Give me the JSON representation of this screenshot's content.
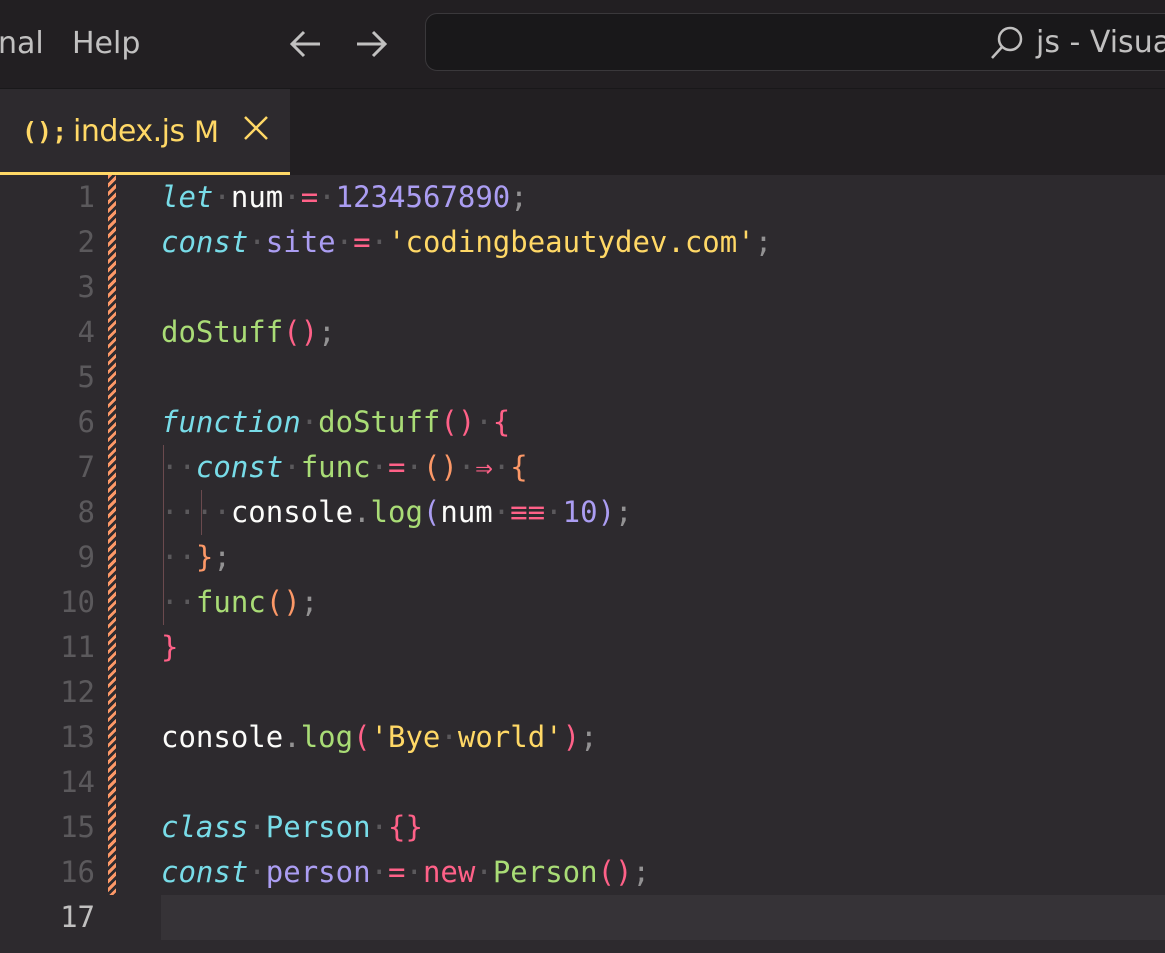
{
  "menu": {
    "items": [
      "nal",
      "Help"
    ]
  },
  "search": {
    "text": "js - Visual"
  },
  "tab": {
    "icon_text": "();",
    "filename": "index.js",
    "status": "M"
  },
  "editor": {
    "active_line": 17,
    "line_numbers": [
      "1",
      "2",
      "3",
      "4",
      "5",
      "6",
      "7",
      "8",
      "9",
      "10",
      "11",
      "12",
      "13",
      "14",
      "15",
      "16",
      "17"
    ],
    "lines": [
      [
        [
          "kw-i",
          "let"
        ],
        [
          "ws",
          "·"
        ],
        [
          "var",
          "num"
        ],
        [
          "ws",
          "·"
        ],
        [
          "op",
          "="
        ],
        [
          "ws",
          "·"
        ],
        [
          "num",
          "1234567890"
        ],
        [
          "punct",
          ";"
        ]
      ],
      [
        [
          "kw-i",
          "const"
        ],
        [
          "ws",
          "·"
        ],
        [
          "prop",
          "site"
        ],
        [
          "ws",
          "·"
        ],
        [
          "op",
          "="
        ],
        [
          "ws",
          "·"
        ],
        [
          "str",
          "'codingbeautydev.com'"
        ],
        [
          "punct",
          ";"
        ]
      ],
      [],
      [
        [
          "fn",
          "doStuff"
        ],
        [
          "br1",
          "()"
        ],
        [
          "punct",
          ";"
        ]
      ],
      [],
      [
        [
          "kw-i",
          "function"
        ],
        [
          "ws",
          "·"
        ],
        [
          "fn",
          "doStuff"
        ],
        [
          "br1",
          "()"
        ],
        [
          "ws",
          "·"
        ],
        [
          "br1",
          "{"
        ]
      ],
      [
        [
          "ws",
          "··"
        ],
        [
          "kw-i",
          "const"
        ],
        [
          "ws",
          "·"
        ],
        [
          "fn",
          "func"
        ],
        [
          "ws",
          "·"
        ],
        [
          "op",
          "="
        ],
        [
          "ws",
          "·"
        ],
        [
          "br2",
          "()"
        ],
        [
          "ws",
          "·"
        ],
        [
          "op",
          "⇒"
        ],
        [
          "ws",
          "·"
        ],
        [
          "br2",
          "{"
        ]
      ],
      [
        [
          "ws",
          "····"
        ],
        [
          "var",
          "console"
        ],
        [
          "punct",
          "."
        ],
        [
          "fn",
          "log"
        ],
        [
          "br3",
          "("
        ],
        [
          "var",
          "num"
        ],
        [
          "ws",
          "·"
        ],
        [
          "op",
          "≡≡"
        ],
        [
          "ws",
          "·"
        ],
        [
          "num",
          "10"
        ],
        [
          "br3",
          ")"
        ],
        [
          "punct",
          ";"
        ]
      ],
      [
        [
          "ws",
          "··"
        ],
        [
          "br2",
          "}"
        ],
        [
          "punct",
          ";"
        ]
      ],
      [
        [
          "ws",
          "··"
        ],
        [
          "fn",
          "func"
        ],
        [
          "br2",
          "()"
        ],
        [
          "punct",
          ";"
        ]
      ],
      [
        [
          "br1",
          "}"
        ]
      ],
      [],
      [
        [
          "var",
          "console"
        ],
        [
          "punct",
          "."
        ],
        [
          "fn",
          "log"
        ],
        [
          "br1",
          "("
        ],
        [
          "str",
          "'Bye"
        ],
        [
          "ws",
          "·"
        ],
        [
          "str",
          "world'"
        ],
        [
          "br1",
          ")"
        ],
        [
          "punct",
          ";"
        ]
      ],
      [],
      [
        [
          "kw-i",
          "class"
        ],
        [
          "ws",
          "·"
        ],
        [
          "cls",
          "Person"
        ],
        [
          "ws",
          "·"
        ],
        [
          "br1",
          "{}"
        ]
      ],
      [
        [
          "kw-i",
          "const"
        ],
        [
          "ws",
          "·"
        ],
        [
          "prop",
          "person"
        ],
        [
          "ws",
          "·"
        ],
        [
          "op",
          "="
        ],
        [
          "ws",
          "·"
        ],
        [
          "op",
          "new"
        ],
        [
          "ws",
          "·"
        ],
        [
          "fn",
          "Person"
        ],
        [
          "br1",
          "()"
        ],
        [
          "punct",
          ";"
        ]
      ],
      []
    ]
  },
  "colors": {
    "background": "#2d2a2e",
    "accent": "#ffd866",
    "keyword": "#78dce8",
    "string": "#ffd866",
    "function": "#a9dc76",
    "number": "#ab9df2",
    "operator": "#ff6188",
    "modified": "#fc9867"
  },
  "icons": [
    "back-arrow-icon",
    "forward-arrow-icon",
    "search-icon",
    "javascript-file-icon",
    "close-icon"
  ]
}
